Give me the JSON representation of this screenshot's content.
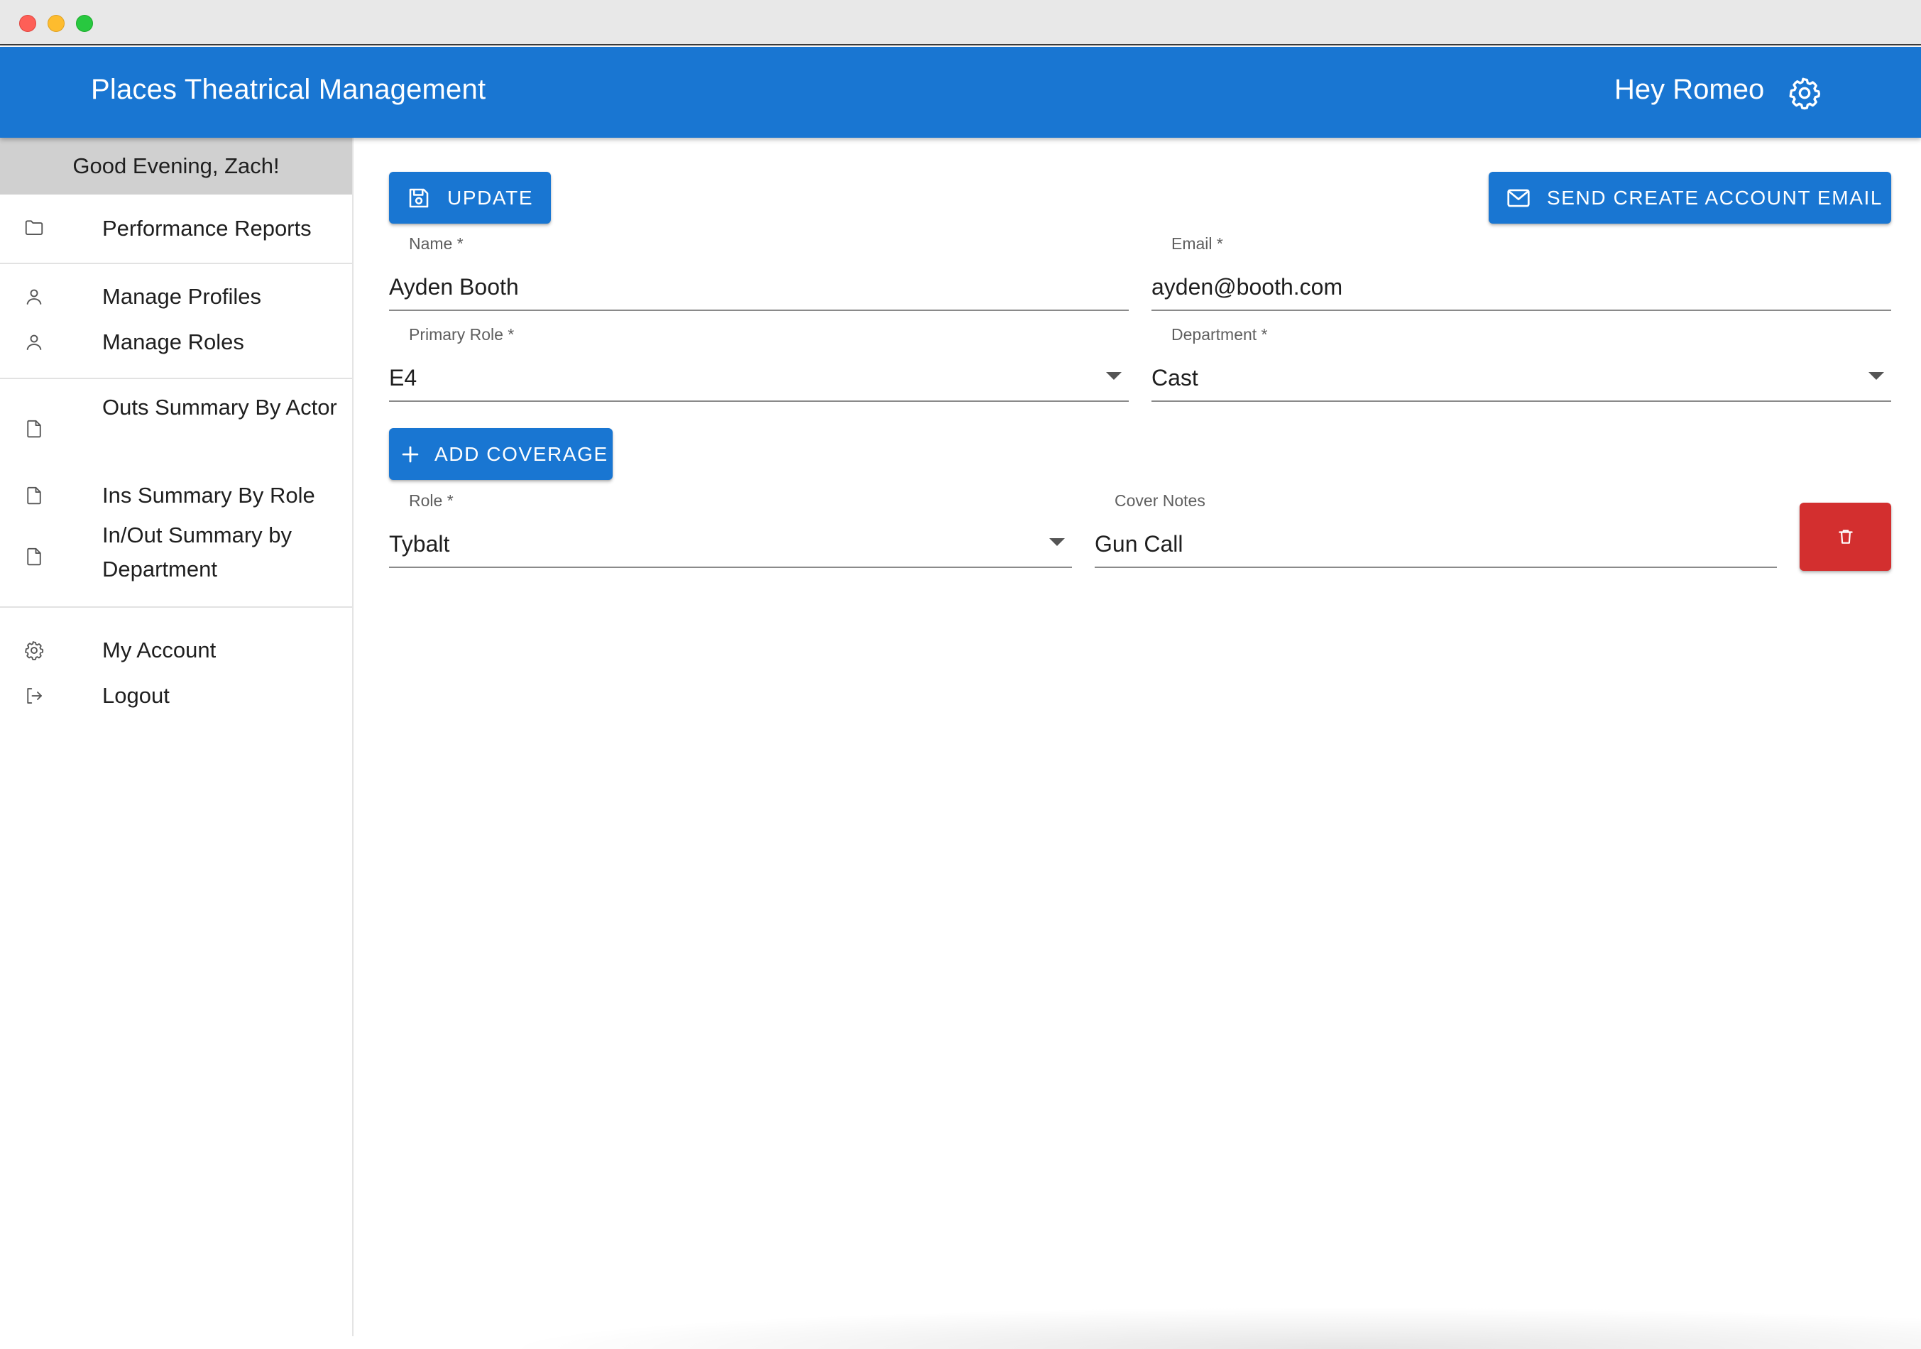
{
  "window": {
    "controls": [
      "close",
      "minimize",
      "zoom"
    ]
  },
  "appbar": {
    "title": "Places Theatrical Management",
    "greeting": "Hey Romeo",
    "settings_icon": "gear-icon",
    "color": "#1976d2"
  },
  "sidebar": {
    "greeting": "Good Evening, Zach!",
    "items": [
      {
        "label": "Performance Reports",
        "icon": "folder-icon"
      },
      {
        "label": "Manage Profiles",
        "icon": "person-icon"
      },
      {
        "label": "Manage Roles",
        "icon": "person-icon"
      },
      {
        "label": "Outs Summary By Actor",
        "icon": "document-icon"
      },
      {
        "label": "Ins Summary By Role",
        "icon": "document-icon"
      },
      {
        "label": "In/Out Summary by Department",
        "icon": "document-icon"
      },
      {
        "label": "My Account",
        "icon": "gear-icon"
      },
      {
        "label": "Logout",
        "icon": "logout-icon"
      }
    ]
  },
  "form": {
    "update_label": "UPDATE",
    "send_email_label": "SEND CREATE ACCOUNT EMAIL",
    "name": {
      "label": "Name *",
      "value": "Ayden Booth"
    },
    "email": {
      "label": "Email *",
      "value": "ayden@booth.com"
    },
    "primary_role": {
      "label": "Primary Role *",
      "value": "E4"
    },
    "department": {
      "label": "Department *",
      "value": "Cast"
    },
    "add_coverage_label": "ADD COVERAGE",
    "coverage": [
      {
        "role": {
          "label": "Role *",
          "value": "Tybalt"
        },
        "cover_notes": {
          "label": "Cover Notes",
          "value": "Gun Call"
        }
      }
    ]
  },
  "colors": {
    "primary": "#1976d2",
    "danger": "#d32f2f",
    "sidebar_header_bg": "#d0d0d0"
  }
}
